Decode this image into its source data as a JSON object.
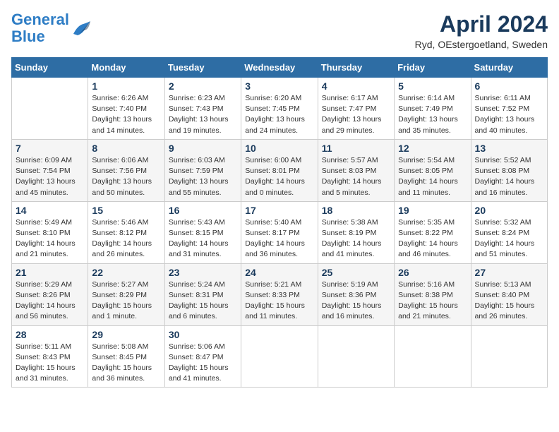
{
  "header": {
    "logo_line1": "General",
    "logo_line2": "Blue",
    "title": "April 2024",
    "subtitle": "Ryd, OEstergoetland, Sweden"
  },
  "weekdays": [
    "Sunday",
    "Monday",
    "Tuesday",
    "Wednesday",
    "Thursday",
    "Friday",
    "Saturday"
  ],
  "weeks": [
    [
      {
        "day": "",
        "info": ""
      },
      {
        "day": "1",
        "info": "Sunrise: 6:26 AM\nSunset: 7:40 PM\nDaylight: 13 hours\nand 14 minutes."
      },
      {
        "day": "2",
        "info": "Sunrise: 6:23 AM\nSunset: 7:43 PM\nDaylight: 13 hours\nand 19 minutes."
      },
      {
        "day": "3",
        "info": "Sunrise: 6:20 AM\nSunset: 7:45 PM\nDaylight: 13 hours\nand 24 minutes."
      },
      {
        "day": "4",
        "info": "Sunrise: 6:17 AM\nSunset: 7:47 PM\nDaylight: 13 hours\nand 29 minutes."
      },
      {
        "day": "5",
        "info": "Sunrise: 6:14 AM\nSunset: 7:49 PM\nDaylight: 13 hours\nand 35 minutes."
      },
      {
        "day": "6",
        "info": "Sunrise: 6:11 AM\nSunset: 7:52 PM\nDaylight: 13 hours\nand 40 minutes."
      }
    ],
    [
      {
        "day": "7",
        "info": "Sunrise: 6:09 AM\nSunset: 7:54 PM\nDaylight: 13 hours\nand 45 minutes."
      },
      {
        "day": "8",
        "info": "Sunrise: 6:06 AM\nSunset: 7:56 PM\nDaylight: 13 hours\nand 50 minutes."
      },
      {
        "day": "9",
        "info": "Sunrise: 6:03 AM\nSunset: 7:59 PM\nDaylight: 13 hours\nand 55 minutes."
      },
      {
        "day": "10",
        "info": "Sunrise: 6:00 AM\nSunset: 8:01 PM\nDaylight: 14 hours\nand 0 minutes."
      },
      {
        "day": "11",
        "info": "Sunrise: 5:57 AM\nSunset: 8:03 PM\nDaylight: 14 hours\nand 5 minutes."
      },
      {
        "day": "12",
        "info": "Sunrise: 5:54 AM\nSunset: 8:05 PM\nDaylight: 14 hours\nand 11 minutes."
      },
      {
        "day": "13",
        "info": "Sunrise: 5:52 AM\nSunset: 8:08 PM\nDaylight: 14 hours\nand 16 minutes."
      }
    ],
    [
      {
        "day": "14",
        "info": "Sunrise: 5:49 AM\nSunset: 8:10 PM\nDaylight: 14 hours\nand 21 minutes."
      },
      {
        "day": "15",
        "info": "Sunrise: 5:46 AM\nSunset: 8:12 PM\nDaylight: 14 hours\nand 26 minutes."
      },
      {
        "day": "16",
        "info": "Sunrise: 5:43 AM\nSunset: 8:15 PM\nDaylight: 14 hours\nand 31 minutes."
      },
      {
        "day": "17",
        "info": "Sunrise: 5:40 AM\nSunset: 8:17 PM\nDaylight: 14 hours\nand 36 minutes."
      },
      {
        "day": "18",
        "info": "Sunrise: 5:38 AM\nSunset: 8:19 PM\nDaylight: 14 hours\nand 41 minutes."
      },
      {
        "day": "19",
        "info": "Sunrise: 5:35 AM\nSunset: 8:22 PM\nDaylight: 14 hours\nand 46 minutes."
      },
      {
        "day": "20",
        "info": "Sunrise: 5:32 AM\nSunset: 8:24 PM\nDaylight: 14 hours\nand 51 minutes."
      }
    ],
    [
      {
        "day": "21",
        "info": "Sunrise: 5:29 AM\nSunset: 8:26 PM\nDaylight: 14 hours\nand 56 minutes."
      },
      {
        "day": "22",
        "info": "Sunrise: 5:27 AM\nSunset: 8:29 PM\nDaylight: 15 hours\nand 1 minute."
      },
      {
        "day": "23",
        "info": "Sunrise: 5:24 AM\nSunset: 8:31 PM\nDaylight: 15 hours\nand 6 minutes."
      },
      {
        "day": "24",
        "info": "Sunrise: 5:21 AM\nSunset: 8:33 PM\nDaylight: 15 hours\nand 11 minutes."
      },
      {
        "day": "25",
        "info": "Sunrise: 5:19 AM\nSunset: 8:36 PM\nDaylight: 15 hours\nand 16 minutes."
      },
      {
        "day": "26",
        "info": "Sunrise: 5:16 AM\nSunset: 8:38 PM\nDaylight: 15 hours\nand 21 minutes."
      },
      {
        "day": "27",
        "info": "Sunrise: 5:13 AM\nSunset: 8:40 PM\nDaylight: 15 hours\nand 26 minutes."
      }
    ],
    [
      {
        "day": "28",
        "info": "Sunrise: 5:11 AM\nSunset: 8:43 PM\nDaylight: 15 hours\nand 31 minutes."
      },
      {
        "day": "29",
        "info": "Sunrise: 5:08 AM\nSunset: 8:45 PM\nDaylight: 15 hours\nand 36 minutes."
      },
      {
        "day": "30",
        "info": "Sunrise: 5:06 AM\nSunset: 8:47 PM\nDaylight: 15 hours\nand 41 minutes."
      },
      {
        "day": "",
        "info": ""
      },
      {
        "day": "",
        "info": ""
      },
      {
        "day": "",
        "info": ""
      },
      {
        "day": "",
        "info": ""
      }
    ]
  ]
}
